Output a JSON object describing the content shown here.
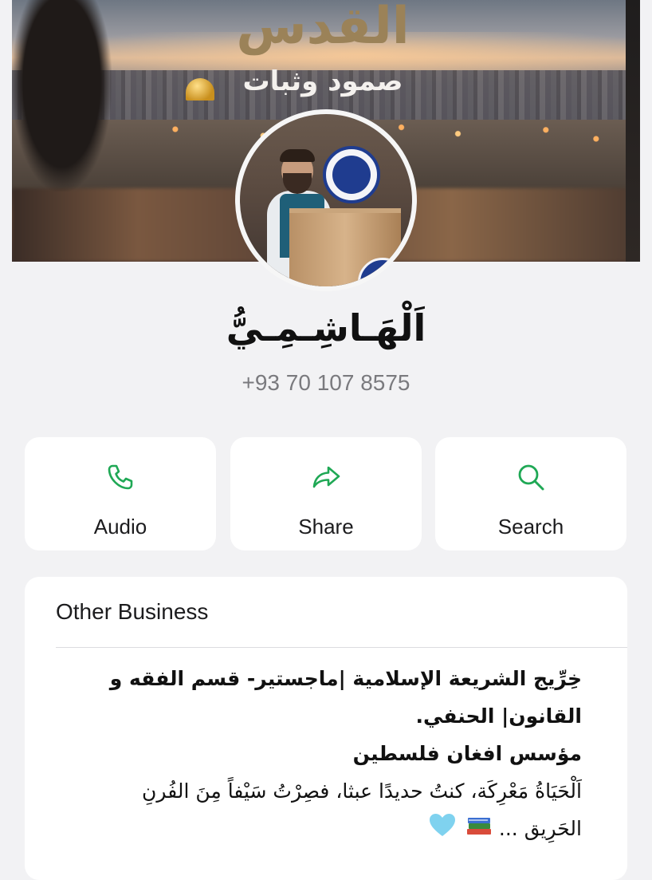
{
  "cover": {
    "title": "القدس",
    "subtitle": "صمود وثبات"
  },
  "profile": {
    "name": "اَلْهَـاشِـمِـيُّ",
    "phone": "+93 70 107 8575"
  },
  "actions": [
    {
      "label": "Audio",
      "icon": "phone-icon"
    },
    {
      "label": "Share",
      "icon": "share-arrow-icon"
    },
    {
      "label": "Search",
      "icon": "search-icon"
    }
  ],
  "accent_color": "#1fa855",
  "card": {
    "title": "Other Business",
    "bio_line1": "خِرِّيج الشريعة الإسلامية |ماجستير- قسم الفقه و",
    "bio_line2": "القانون| الحنفي.",
    "bio_line3": "مؤسس افغان فلسطين",
    "bio_line4": "اَلْحَيَاةُ مَعْرِكَة، كنتُ حديدًا عبثا، فصِرْتُ سَيْفاً مِنَ الفُرنِ",
    "bio_line5": "الحَرِيق ..."
  }
}
